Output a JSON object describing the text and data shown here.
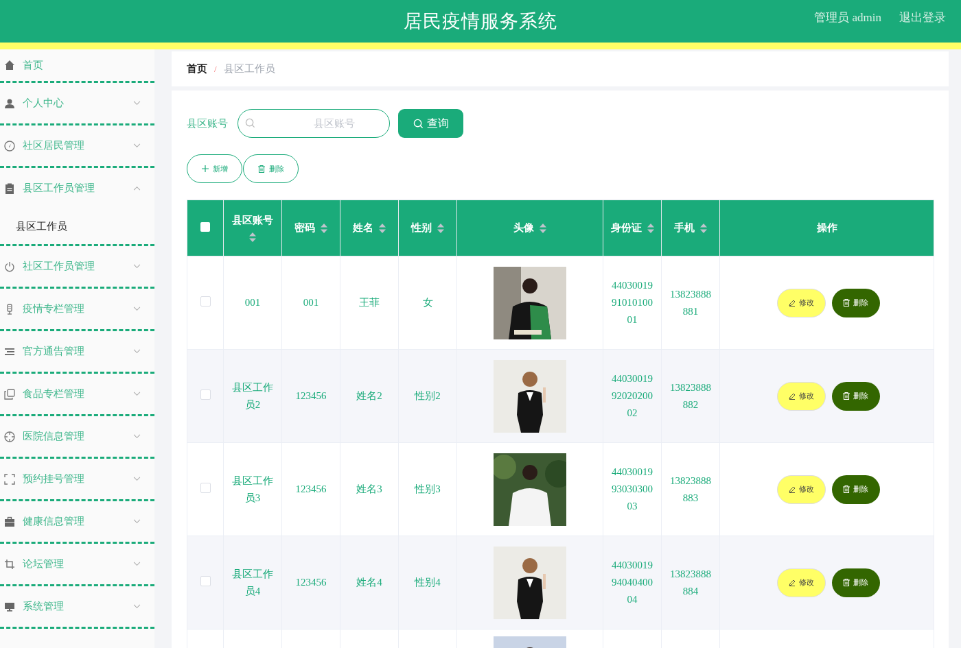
{
  "header": {
    "title": "居民疫情服务系统",
    "user": "管理员 admin",
    "logout": "退出登录"
  },
  "sidebar": {
    "items": [
      {
        "label": "首页",
        "kind": "link"
      },
      {
        "label": "个人中心",
        "kind": "menu",
        "expanded": false
      },
      {
        "label": "社区居民管理",
        "kind": "menu",
        "expanded": false
      },
      {
        "label": "县区工作员管理",
        "kind": "menu",
        "expanded": true,
        "children": [
          {
            "label": "县区工作员"
          }
        ]
      },
      {
        "label": "社区工作员管理",
        "kind": "menu",
        "expanded": false
      },
      {
        "label": "疫情专栏管理",
        "kind": "menu",
        "expanded": false
      },
      {
        "label": "官方通告管理",
        "kind": "menu",
        "expanded": false
      },
      {
        "label": "食品专栏管理",
        "kind": "menu",
        "expanded": false
      },
      {
        "label": "医院信息管理",
        "kind": "menu",
        "expanded": false
      },
      {
        "label": "预约挂号管理",
        "kind": "menu",
        "expanded": false
      },
      {
        "label": "健康信息管理",
        "kind": "menu",
        "expanded": false
      },
      {
        "label": "论坛管理",
        "kind": "menu",
        "expanded": false
      },
      {
        "label": "系统管理",
        "kind": "menu",
        "expanded": false
      }
    ]
  },
  "breadcrumb": [
    "首页",
    "/",
    "县区工作员"
  ],
  "search": {
    "label": "县区账号",
    "placeholder": "县区账号",
    "button": "查询"
  },
  "actions": {
    "add": "新增",
    "delete": "删除"
  },
  "table": {
    "select_all": {
      "checked": false
    },
    "columns": [
      {
        "label": "县区账号",
        "sortable": true
      },
      {
        "label": "密码",
        "sortable": true
      },
      {
        "label": "姓名",
        "sortable": true
      },
      {
        "label": "性别",
        "sortable": true
      },
      {
        "label": "头像",
        "sortable": true
      },
      {
        "label": "身份证",
        "sortable": true
      },
      {
        "label": "手机",
        "sortable": true
      },
      {
        "label": "操作",
        "sortable": false
      }
    ],
    "rows": [
      {
        "checked": false,
        "cells": [
          "001",
          "001",
          "王菲",
          "女"
        ],
        "id_card": "440300199101010001",
        "phone": "13823888881",
        "edit": "修改",
        "delete": "删除"
      },
      {
        "checked": false,
        "cells": [
          "县区工作员2",
          "123456",
          "姓名2",
          "性别2"
        ],
        "id_card": "440300199202020002",
        "phone": "13823888882",
        "edit": "修改",
        "delete": "删除"
      },
      {
        "checked": false,
        "cells": [
          "县区工作员3",
          "123456",
          "姓名3",
          "性别3"
        ],
        "id_card": "440300199303030003",
        "phone": "13823888883",
        "edit": "修改",
        "delete": "删除"
      },
      {
        "checked": false,
        "cells": [
          "县区工作员4",
          "123456",
          "姓名4",
          "性别4"
        ],
        "id_card": "440300199404040004",
        "phone": "13823888884",
        "edit": "修改",
        "delete": "删除"
      }
    ]
  }
}
